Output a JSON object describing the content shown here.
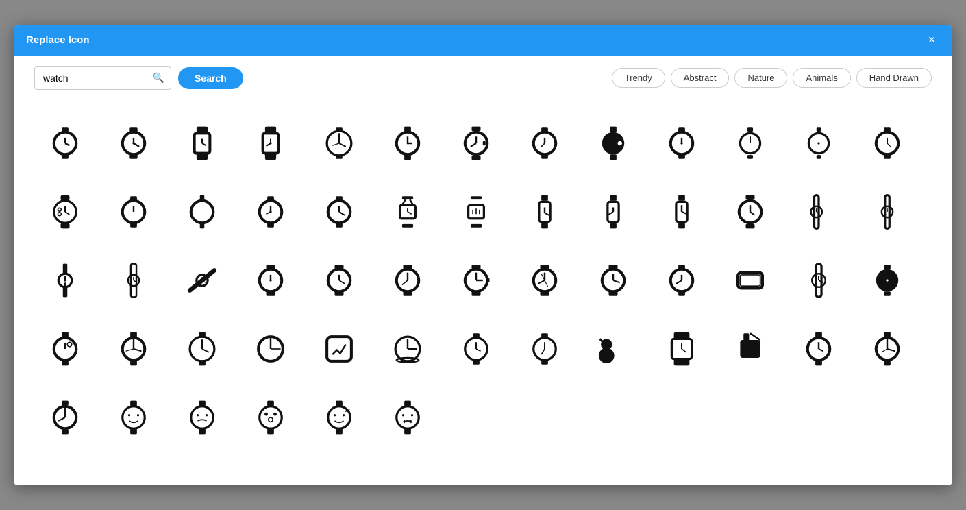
{
  "modal": {
    "title": "Replace Icon",
    "close_label": "×"
  },
  "search": {
    "value": "watch",
    "placeholder": "watch",
    "button_label": "Search"
  },
  "filters": [
    {
      "label": "Trendy",
      "id": "trendy"
    },
    {
      "label": "Abstract",
      "id": "abstract"
    },
    {
      "label": "Nature",
      "id": "nature"
    },
    {
      "label": "Animals",
      "id": "animals"
    },
    {
      "label": "Hand Drawn",
      "id": "hand-drawn"
    }
  ],
  "scrollbar": {
    "visible": true
  }
}
